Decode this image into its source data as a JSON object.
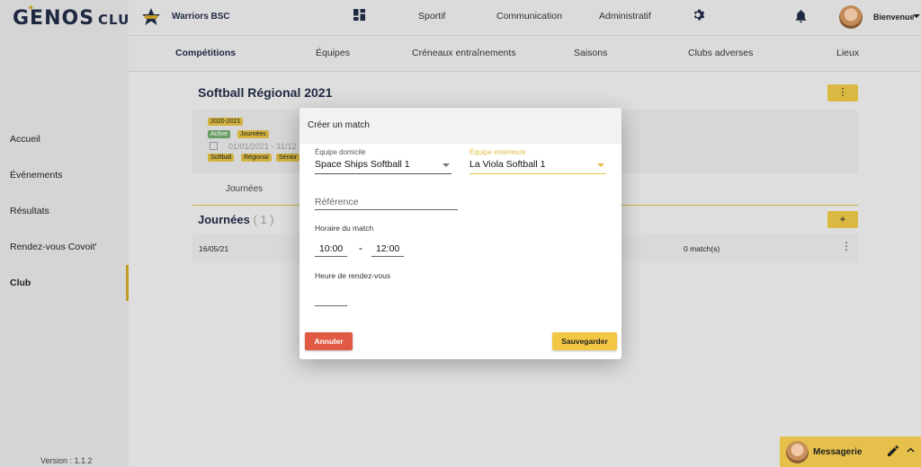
{
  "brand": {
    "name": "GENOS",
    "suffix": "CLUBS"
  },
  "sidebar": {
    "items": [
      {
        "label": "Accueil"
      },
      {
        "label": "Événements"
      },
      {
        "label": "Résultats"
      },
      {
        "label": "Rendez-vous Covoit'"
      },
      {
        "label": "Club"
      }
    ],
    "active_item": "Club",
    "version": "Version : 1.1.2"
  },
  "topbar": {
    "club_name": "Warriors BSC",
    "dashboard_icon": "dashboard-icon",
    "links": [
      "Sportif",
      "Communication",
      "Administratif"
    ],
    "settings_icon": "gear-icon",
    "notifications_icon": "bell-icon",
    "user_greeting": "Bienvenue"
  },
  "subtabs": {
    "items": [
      "Compétitions",
      "Équipes",
      "Créneaux entraînements",
      "Saisons",
      "Clubs adverses",
      "Lieux"
    ],
    "active": "Compétitions"
  },
  "competition": {
    "title": "Softball Régional 2021",
    "season": "2020-2021",
    "status_chips": [
      "Active",
      "Journées"
    ],
    "date_range": "01/01/2021 - 31/12",
    "tags": [
      "Softball",
      "Régional",
      "Sénior"
    ],
    "menu_icon": "more-vertical-icon"
  },
  "rounds": {
    "tab_label": "Journées",
    "section_title": "Journées",
    "count": "( 1 )",
    "add_label": "+",
    "rows": [
      {
        "date": "16/05/21",
        "matches": "0 match(s)"
      }
    ]
  },
  "modal": {
    "title": "Créer un match",
    "home_team": {
      "label": "Équipe domicile",
      "value": "Space Ships Softball 1"
    },
    "away_team": {
      "label": "Équipe extérieure",
      "value": "La Viola Softball 1"
    },
    "reference": {
      "placeholder": "Référence",
      "value": ""
    },
    "schedule": {
      "label": "Horaire du match",
      "start": "10:00",
      "separator": "-",
      "end": "12:00"
    },
    "meeting_time": {
      "label": "Heure de rendez-vous",
      "value": ""
    },
    "cancel_label": "Annuler",
    "save_label": "Sauvegarder"
  },
  "messaging": {
    "label": "Messagerie",
    "edit_icon": "pencil-icon",
    "toggle_icon": "chevron-up-icon"
  },
  "colors": {
    "accent": "#e0bf45",
    "navy": "#1f2a44",
    "cancel": "#e15a44",
    "save": "#f2c744",
    "active_chip": "#6da36a"
  }
}
